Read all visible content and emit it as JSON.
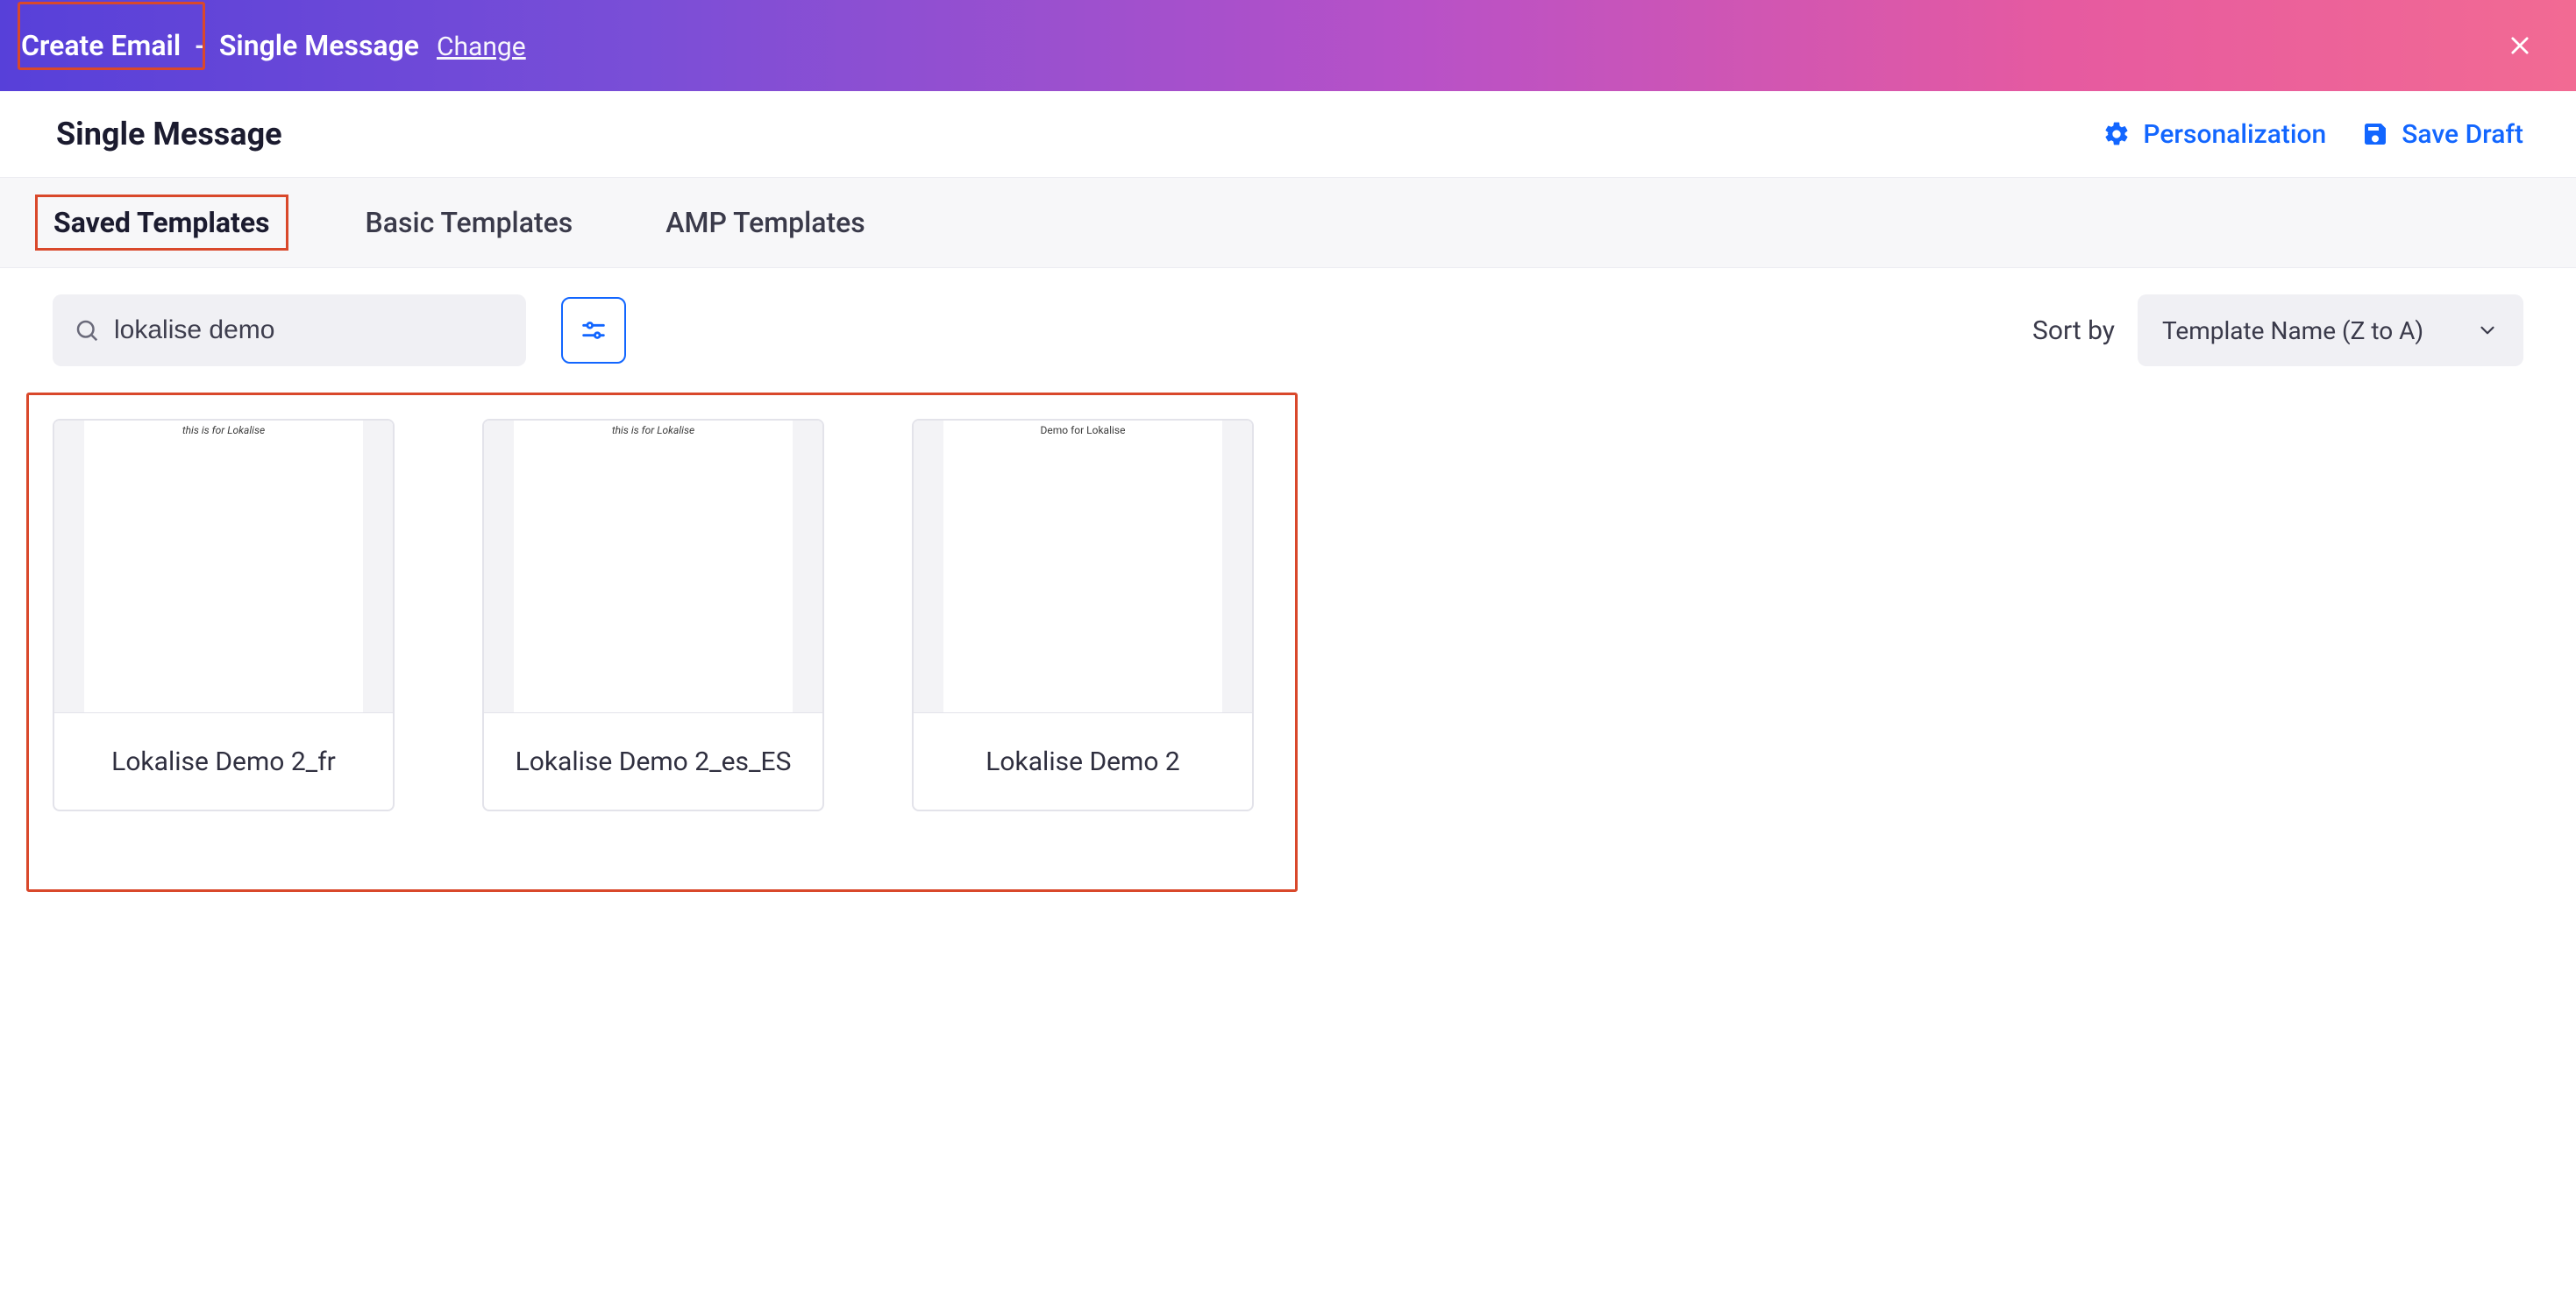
{
  "topbar": {
    "main": "Create Email",
    "separator": "-",
    "sub": "Single Message",
    "change": "Change"
  },
  "subheader": {
    "title": "Single Message",
    "actions": {
      "personalization": "Personalization",
      "save_draft": "Save Draft"
    }
  },
  "tabs": {
    "saved": "Saved Templates",
    "basic": "Basic Templates",
    "amp": "AMP Templates"
  },
  "toolbar": {
    "search_value": "lokalise demo",
    "sort_label": "Sort by",
    "sort_value": "Template Name (Z to A)"
  },
  "templates": [
    {
      "name": "Lokalise Demo 2_fr",
      "preview_text": "this is for Lokalise",
      "italic": true
    },
    {
      "name": "Lokalise Demo 2_es_ES",
      "preview_text": "this is for Lokalise",
      "italic": true
    },
    {
      "name": "Lokalise Demo 2",
      "preview_text": "Demo for Lokalise",
      "italic": false
    }
  ]
}
